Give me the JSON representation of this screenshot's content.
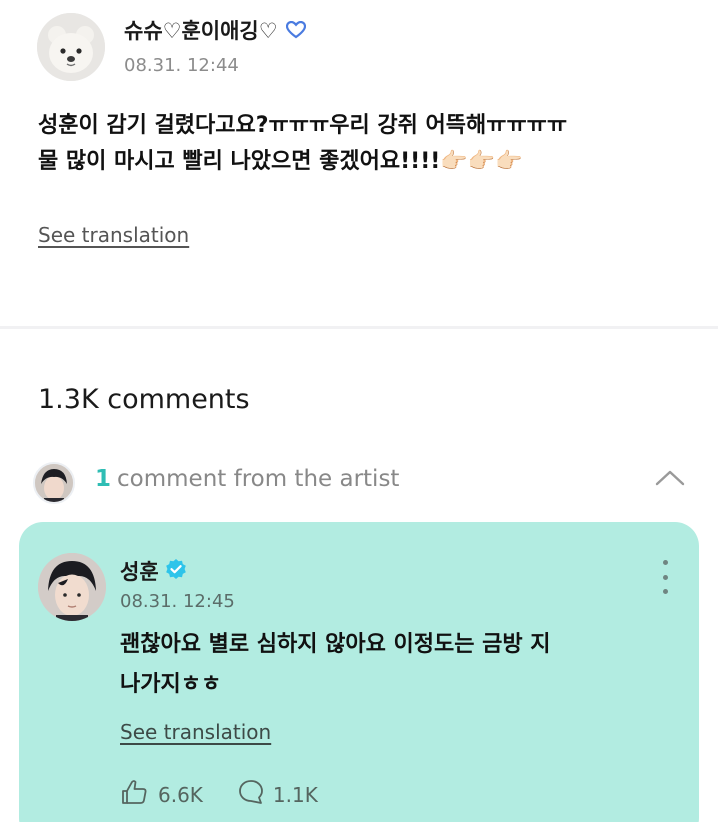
{
  "post": {
    "author": "슈슈♡훈이애깅♡",
    "date": "08.31. 12:44",
    "body_line1": "성훈이 감기 걸렸다고요?ㅠㅠㅠ우리 강쥐 어뜩해ㅠㅠㅠㅠ",
    "body_line2": "물 많이 마시고 빨리 나았으면 좋겠어요!!!!👉🏻👉🏻👉🏻",
    "see_translation": "See translation"
  },
  "comments": {
    "count_label": "1.3K comments",
    "artist_count": "1",
    "artist_label": "comment from the artist"
  },
  "artist_comment": {
    "name": "성훈",
    "date": "08.31. 12:45",
    "body_line1": "괜찮아요 별로 심하지 않아요 이정도는 금방 지",
    "body_line2": "나가지ㅎㅎ",
    "see_translation": "See translation",
    "likes": "6.6K",
    "replies": "1.1K"
  },
  "icons": {
    "author_badge": "blue-heart-icon",
    "verified": "verified-badge-icon",
    "collapse": "chevron-up-icon",
    "more": "more-vertical-icon",
    "like": "like-hand-icon",
    "reply": "comment-bubble-icon"
  },
  "colors": {
    "accent": "#2fbdb4",
    "card_background": "#b2ece1"
  }
}
